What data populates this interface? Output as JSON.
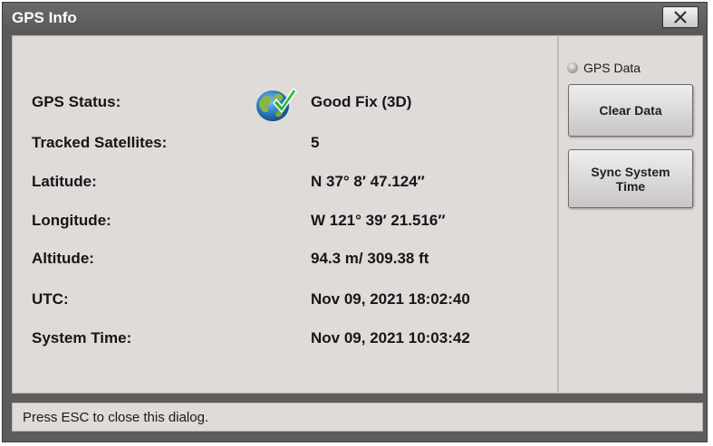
{
  "window": {
    "title": "GPS Info"
  },
  "info": {
    "rows": [
      {
        "label": "GPS Status:",
        "value": "Good Fix (3D)"
      },
      {
        "label": "Tracked Satellites:",
        "value": "5"
      },
      {
        "label": "Latitude:",
        "value": "N 37° 8′ 47.124″"
      },
      {
        "label": "Longitude:",
        "value": "W 121° 39′ 21.516″"
      },
      {
        "label": "Altitude:",
        "value": "94.3 m/ 309.38 ft"
      },
      {
        "label": "UTC:",
        "value": "Nov 09, 2021 18:02:40"
      },
      {
        "label": "System Time:",
        "value": "Nov 09, 2021 10:03:42"
      }
    ],
    "status_icon": "globe-check-icon"
  },
  "side": {
    "indicator_label": "GPS Data",
    "clear_label": "Clear Data",
    "sync_label": "Sync System Time"
  },
  "statusbar": {
    "text": "Press ESC to close this dialog."
  },
  "colors": {
    "titlebar": "#5c5c5c",
    "panel": "#dedbd9",
    "check_green": "#2eb82e",
    "globe_blue": "#1d6fb8"
  }
}
